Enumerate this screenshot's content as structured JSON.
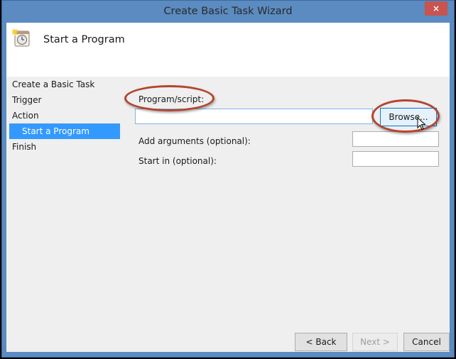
{
  "window": {
    "title": "Create Basic Task Wizard",
    "close_label": "×"
  },
  "header": {
    "icon": "task-scheduler-clock-icon",
    "title": "Start a Program"
  },
  "sidebar": {
    "steps": [
      {
        "label": "Create a Basic Task",
        "active": false
      },
      {
        "label": "Trigger",
        "active": false
      },
      {
        "label": "Action",
        "active": false
      },
      {
        "label": "Start a Program",
        "active": true
      },
      {
        "label": "Finish",
        "active": false
      }
    ]
  },
  "form": {
    "program_label": "Program/script:",
    "program_value": "",
    "browse_label": "Browse...",
    "arguments_label": "Add arguments (optional):",
    "arguments_value": "",
    "start_in_label": "Start in (optional):",
    "start_in_value": ""
  },
  "footer": {
    "back_label": "< Back",
    "next_label": "Next >",
    "cancel_label": "Cancel"
  },
  "colors": {
    "title_bar": "#5b8bc0",
    "close_button": "#c9534f",
    "selected_step": "#3399ff",
    "annotation": "#b5442f"
  }
}
